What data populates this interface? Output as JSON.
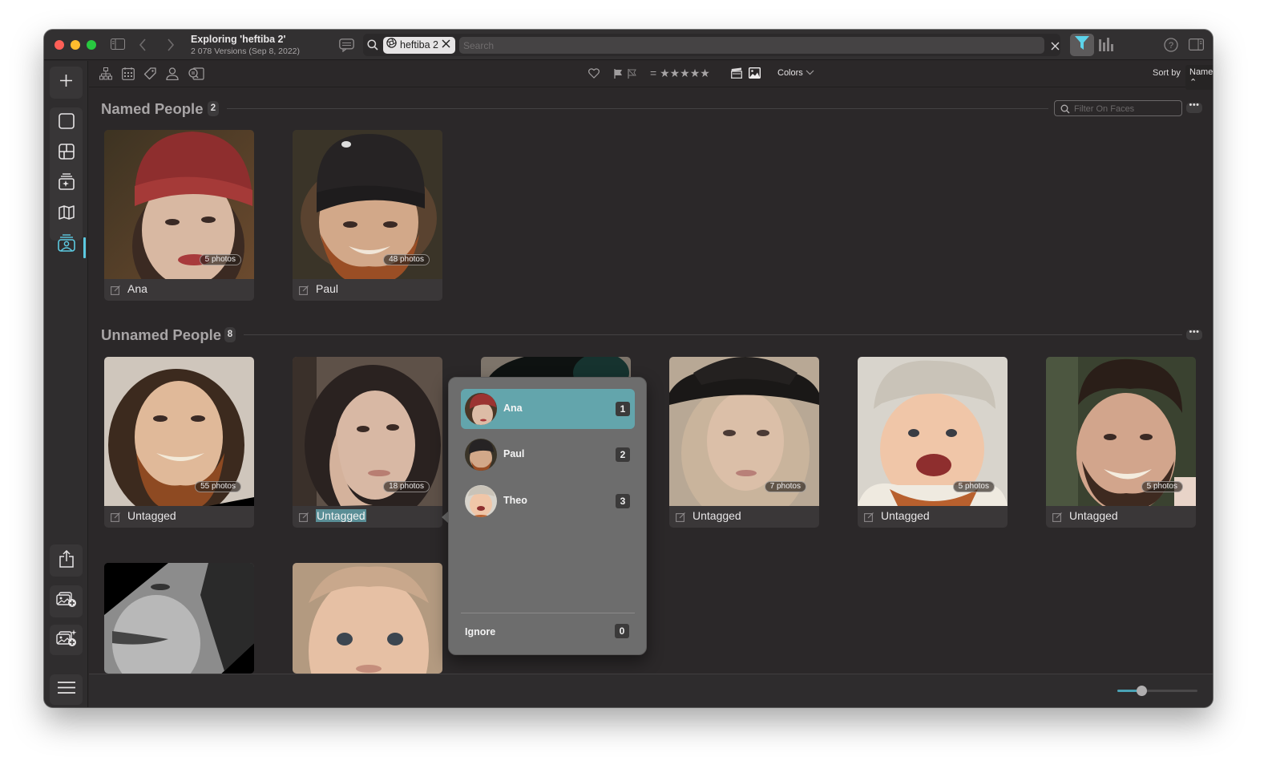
{
  "window": {
    "title": "Exploring 'heftiba 2'",
    "subtitle": "2 078 Versions (Sep 8, 2022)"
  },
  "search": {
    "token_label": "heftiba 2",
    "placeholder": "Search",
    "value": ""
  },
  "toolbar": {
    "stars_prefix": "=",
    "stars": "★★★★★",
    "colors_label": "Colors",
    "sort_by_label": "Sort by",
    "sort_value": "Name ⌃",
    "filter_faces_placeholder": "Filter On Faces"
  },
  "sections": {
    "named": {
      "title": "Named People",
      "count": "2",
      "people": [
        {
          "name": "Ana",
          "photos": "5 photos"
        },
        {
          "name": "Paul",
          "photos": "48 photos"
        }
      ]
    },
    "unnamed": {
      "title": "Unnamed People",
      "count": "8",
      "people": [
        {
          "name": "Untagged",
          "photos": "55 photos"
        },
        {
          "name": "Untagged",
          "photos": "18 photos",
          "selected": true
        },
        {
          "name": "",
          "photos": ""
        },
        {
          "name": "Untagged",
          "photos": "7 photos"
        },
        {
          "name": "Untagged",
          "photos": "5 photos"
        },
        {
          "name": "Untagged",
          "photos": "5 photos"
        },
        {
          "name": "",
          "photos": ""
        },
        {
          "name": "",
          "photos": ""
        }
      ]
    }
  },
  "popover": {
    "items": [
      {
        "name": "Ana",
        "key": "1",
        "active": true
      },
      {
        "name": "Paul",
        "key": "2"
      },
      {
        "name": "Theo",
        "key": "3"
      }
    ],
    "ignore_label": "Ignore",
    "ignore_key": "0"
  },
  "zoom_slider": {
    "value_fraction": 0.3
  },
  "colors": {
    "accent": "#5cc9e0",
    "selection": "#63a5ac",
    "background": "#2b2829"
  }
}
